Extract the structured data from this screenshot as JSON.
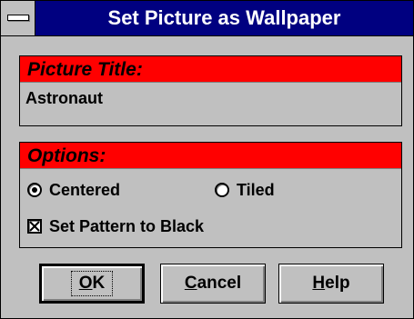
{
  "window": {
    "title": "Set Picture as Wallpaper"
  },
  "picture_group": {
    "header": "Picture Title:",
    "value": "Astronaut"
  },
  "options_group": {
    "header": "Options:",
    "radio_centered": {
      "label": "Centered",
      "selected": true
    },
    "radio_tiled": {
      "label": "Tiled",
      "selected": false
    },
    "checkbox_pattern": {
      "label": "Set Pattern to Black",
      "checked": true
    }
  },
  "buttons": {
    "ok": {
      "mnemonic": "O",
      "rest": "K"
    },
    "cancel": {
      "mnemonic": "C",
      "rest": "ancel"
    },
    "help": {
      "mnemonic": "H",
      "rest": "elp"
    }
  },
  "colors": {
    "titlebar": "#000080",
    "group_header": "#ff0000",
    "face": "#c0c0c0"
  }
}
